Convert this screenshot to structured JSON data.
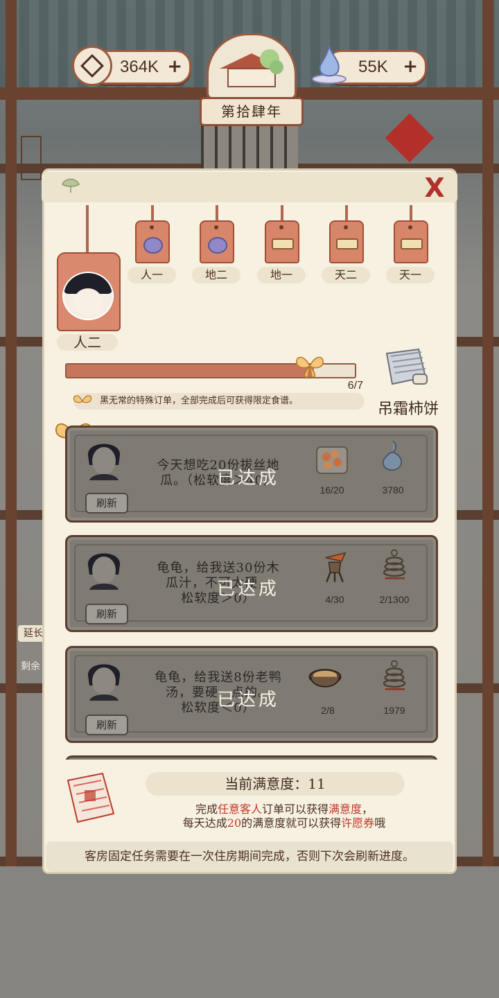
{
  "currency": {
    "coins": "364K",
    "spirit": "55K",
    "plus": "+"
  },
  "year": "第拾肆年",
  "close_label": "X",
  "guest_tags": [
    {
      "label": "人一",
      "icon": "purple-bun-icon"
    },
    {
      "label": "地二",
      "icon": "purple-bun-icon"
    },
    {
      "label": "地一",
      "icon": "ingot-plaque-icon"
    },
    {
      "label": "天二",
      "icon": "ingot-plaque-icon"
    },
    {
      "label": "天一",
      "icon": "ingot-plaque-icon"
    }
  ],
  "current_guest": {
    "label": "人二"
  },
  "progress": {
    "text": "6/7",
    "value": 6,
    "total": 7
  },
  "hint": "黑无常的特殊订单，全部完成后可获得限定食谱。",
  "reward": {
    "name": "吊霜柿饼"
  },
  "orders": [
    {
      "request_lines": [
        "今天想吃20份拔丝地",
        "瓜。（松软度＞40）"
      ],
      "status": "已达成",
      "refresh": "刷新",
      "dish_count": "16/20",
      "reward_value": "3780",
      "dish_icon": "sweet-potato-dish-icon",
      "reward_icon": "spirit-gourd-icon"
    },
    {
      "request_lines": [
        "龟龟，给我送30份木",
        "瓜汁，不可太硬，",
        "松软度＞0）"
      ],
      "status": "已达成",
      "refresh": "刷新",
      "dish_count": "4/30",
      "reward_value": "2/1300",
      "dish_icon": "papaya-juice-icon",
      "reward_icon": "coin-string-icon"
    },
    {
      "request_lines": [
        "龟龟，给我送8份老鸭",
        "汤，要硬一点的。",
        "松软度＜0）"
      ],
      "status": "已达成",
      "refresh": "刷新",
      "dish_count": "2/8",
      "reward_value": "1979",
      "dish_icon": "duck-soup-icon",
      "reward_icon": "coin-string-icon"
    }
  ],
  "satisfaction": {
    "title": "当前满意度：11",
    "line1_a": "完成",
    "line1_b": "任意客人",
    "line1_c": "订单可以获得",
    "line1_d": "满意度",
    "line1_e": "，",
    "line2_a": "每天达成",
    "line2_b": "20",
    "line2_c": "的满意度就可以获得",
    "line2_d": "许愿券",
    "line2_e": "哦"
  },
  "bottom_note": "客房固定任务需要在一次住房期间完成，否则下次会刷新进度。",
  "side_labels": {
    "extend": "延长",
    "remain": "剩余"
  },
  "colors": {
    "accent_red": "#c0392b",
    "card_bg": "#7f7a72",
    "panel_bg": "#f7f1e1"
  }
}
